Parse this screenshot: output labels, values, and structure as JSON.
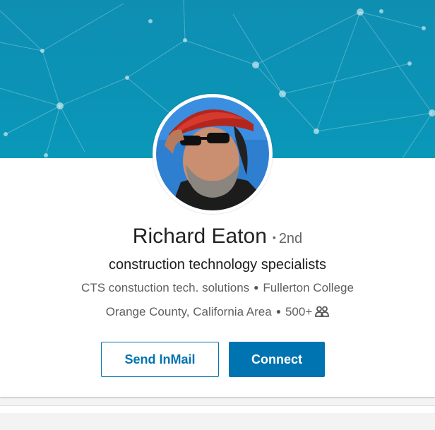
{
  "profile": {
    "name": "Richard Eaton",
    "degree": "2nd",
    "headline": "construction technology specialists",
    "company": "CTS constuction tech. solutions",
    "school": "Fullerton College",
    "location": "Orange County, California Area",
    "connections": "500+",
    "connections_icon": "people-icon",
    "photo": "profile-photo"
  },
  "actions": {
    "send_inmail": "Send InMail",
    "connect": "Connect"
  },
  "colors": {
    "banner": "#0b93b6",
    "accent": "#0073b1"
  }
}
